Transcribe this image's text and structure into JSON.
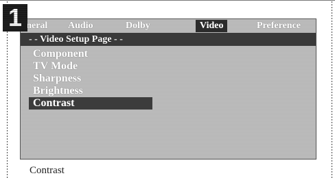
{
  "step_number": "1",
  "tabs": [
    {
      "label": "eneral",
      "active": false
    },
    {
      "label": "Audio",
      "active": false
    },
    {
      "label": "Dolby",
      "active": false
    },
    {
      "label": "Video",
      "active": true
    },
    {
      "label": "Preference",
      "active": false
    }
  ],
  "page_title": "- - Video Setup Page - -",
  "menu_items": [
    {
      "label": "Component",
      "selected": false
    },
    {
      "label": "TV Mode",
      "selected": false
    },
    {
      "label": "Sharpness",
      "selected": false
    },
    {
      "label": "Brightness",
      "selected": false
    },
    {
      "label": "Contrast",
      "selected": true
    }
  ],
  "help_text": "Contrast"
}
